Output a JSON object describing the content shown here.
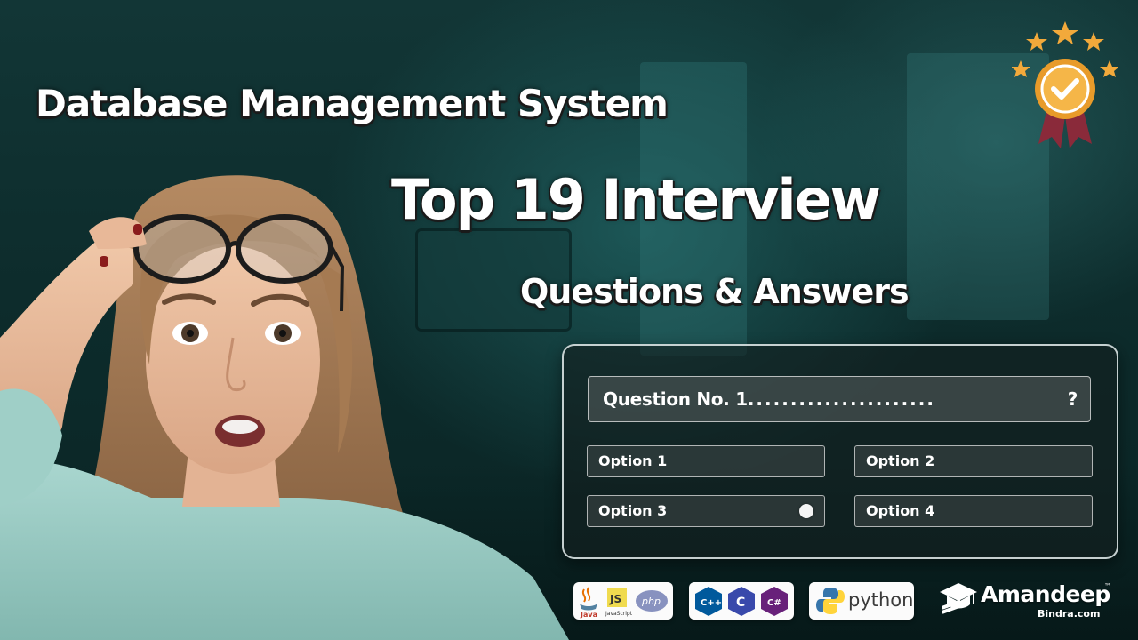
{
  "headline": {
    "line1": "Database Management System",
    "line2": "Top 19 Interview",
    "line3": "Questions & Answers"
  },
  "quiz": {
    "question": "Question No. 1",
    "question_dots": "......................",
    "question_mark": "?",
    "options": [
      "Option 1",
      "Option 2",
      "Option 3",
      "Option 4"
    ],
    "selected_option": "Option 3"
  },
  "tech_logos": {
    "java": "Java",
    "javascript": "JS",
    "javascript_caption": "JavaScript",
    "php": "php",
    "cpp": "C++",
    "c": "C",
    "csharp": "C#",
    "python": "python"
  },
  "brand": {
    "name": "Amandeep",
    "site": "Bindra.com",
    "trademark": "™"
  },
  "colors": {
    "background": "#0f3030",
    "gold": "#f2a93b",
    "ribbon": "#8a2a3a",
    "text": "#ffffff"
  }
}
